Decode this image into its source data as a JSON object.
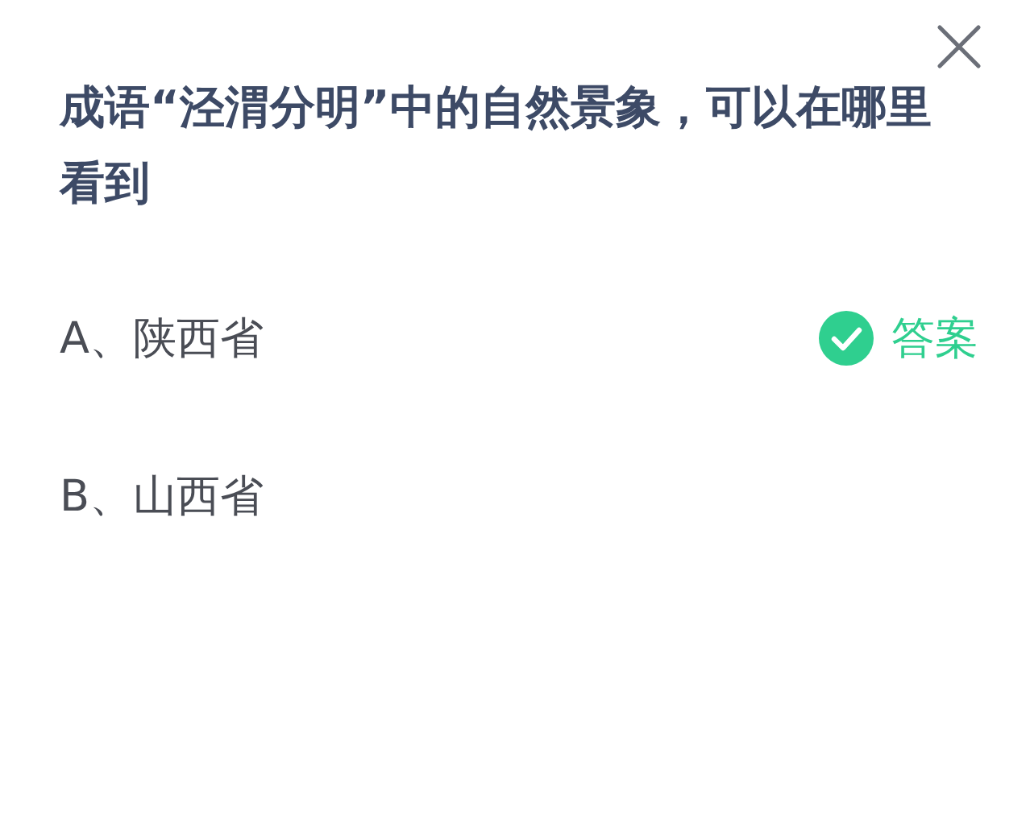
{
  "question": "成语“泾渭分明”中的自然景象，可以在哪里看到",
  "options": [
    {
      "label": "A、陕西省",
      "correct": true
    },
    {
      "label": "B、山西省",
      "correct": false
    }
  ],
  "answer_label": "答案"
}
